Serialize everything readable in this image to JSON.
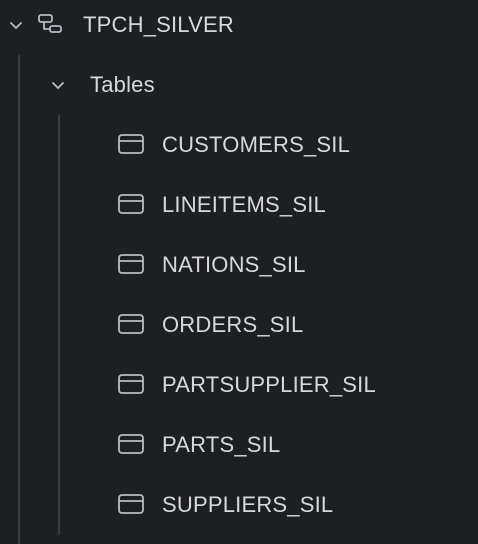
{
  "tree": {
    "schema": {
      "label": "TPCH_SILVER",
      "icon": "schema-icon",
      "expanded": true
    },
    "folder": {
      "label": "Tables",
      "expanded": true
    },
    "tables": [
      {
        "label": "CUSTOMERS_SIL",
        "icon": "table-icon"
      },
      {
        "label": "LINEITEMS_SIL",
        "icon": "table-icon"
      },
      {
        "label": "NATIONS_SIL",
        "icon": "table-icon"
      },
      {
        "label": "ORDERS_SIL",
        "icon": "table-icon"
      },
      {
        "label": "PARTSUPPLIER_SIL",
        "icon": "table-icon"
      },
      {
        "label": "PARTS_SIL",
        "icon": "table-icon"
      },
      {
        "label": "SUPPLIERS_SIL",
        "icon": "table-icon"
      }
    ]
  },
  "colors": {
    "background": "#1e1f22",
    "text": "#d6d8de",
    "icon": "#b9bcc4",
    "guide_line": "#3a3c41"
  }
}
